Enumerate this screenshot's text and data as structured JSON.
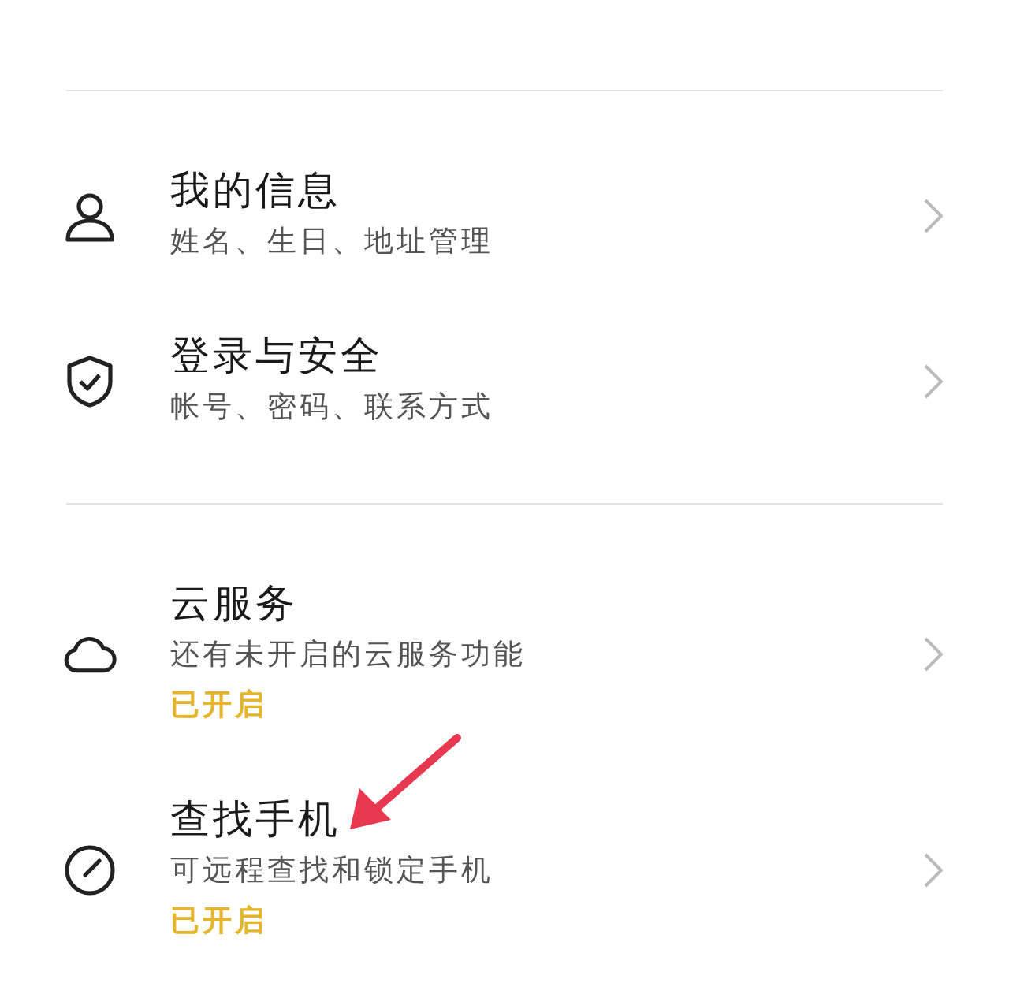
{
  "sections": [
    {
      "items": [
        {
          "kind": "person",
          "title": "我的信息",
          "subtitle": "姓名、生日、地址管理"
        },
        {
          "kind": "shield",
          "title": "登录与安全",
          "subtitle": "帐号、密码、联系方式"
        }
      ]
    },
    {
      "items": [
        {
          "kind": "cloud",
          "title": "云服务",
          "subtitle": "还有未开启的云服务功能",
          "status": "已开启"
        },
        {
          "kind": "gauge",
          "title": "查找手机",
          "subtitle": "可远程查找和锁定手机",
          "status": "已开启"
        }
      ]
    }
  ],
  "annotation": {
    "kind": "arrow"
  }
}
